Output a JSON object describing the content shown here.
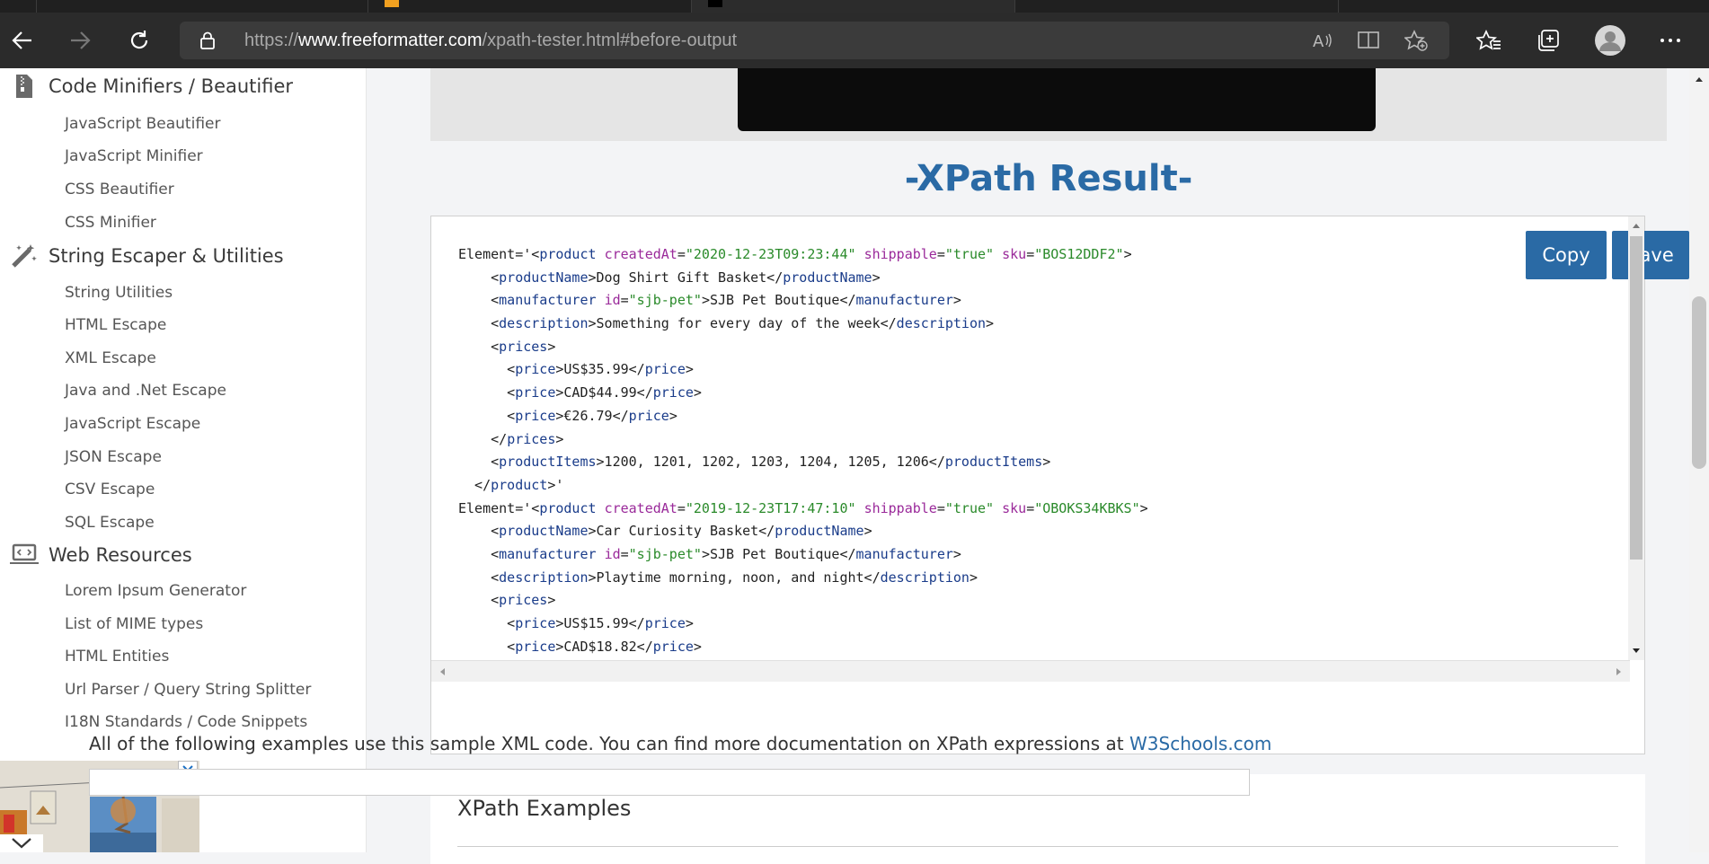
{
  "browser": {
    "url_prefix": "https://",
    "url_domain": "www.freeformatter.com",
    "url_path": "/xpath-tester.html#before-output"
  },
  "sidebar": {
    "sections": [
      {
        "title": "Code Minifiers / Beautifier",
        "icon": "zip-file-icon",
        "items": [
          "JavaScript Beautifier",
          "JavaScript Minifier",
          "CSS Beautifier",
          "CSS Minifier"
        ]
      },
      {
        "title": "String Escaper & Utilities",
        "icon": "magic-wand-icon",
        "items": [
          "String Utilities",
          "HTML Escape",
          "XML Escape",
          "Java and .Net Escape",
          "JavaScript Escape",
          "JSON Escape",
          "CSV Escape",
          "SQL Escape"
        ]
      },
      {
        "title": "Web Resources",
        "icon": "laptop-code-icon",
        "items": [
          "Lorem Ipsum Generator",
          "List of MIME types",
          "HTML Entities",
          "Url Parser / Query String Splitter",
          "I18N Standards / Code Snippets"
        ]
      }
    ]
  },
  "result": {
    "title": "-XPath Result-",
    "copy_label": "Copy",
    "save_label": "Save"
  },
  "examples": {
    "heading": "XPath Examples",
    "text": "All of the following examples use this sample XML code. You can find more documentation on XPath expressions at ",
    "link": "W3Schools.com"
  }
}
